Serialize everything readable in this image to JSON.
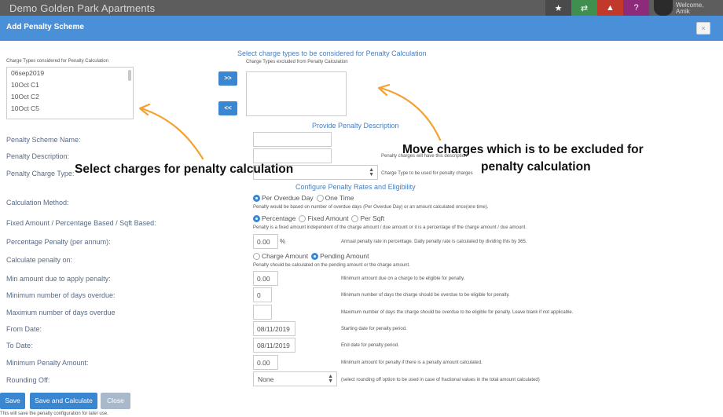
{
  "topbar": {
    "app_title": "Demo Golden Park Apartments",
    "icons": [
      "star-icon",
      "shuffle-icon",
      "bell-icon",
      "help-icon"
    ],
    "welcome_line1": "Welcome,",
    "welcome_line2": "Amik"
  },
  "modal": {
    "title": "Add Penalty Scheme",
    "close_glyph": "×"
  },
  "charge_section": {
    "heading": "Select charge types to be considered for Penalty Calculation",
    "considered_label": "Charge Types considered for Penalty Calculation",
    "excluded_label": "Charge Types excluded from Penalty Calculation",
    "considered_items": [
      "06sep2019",
      "10Oct C1",
      "10Oct C2",
      "10Oct C5"
    ],
    "move_right": ">>",
    "move_left": "<<"
  },
  "description_section": {
    "heading": "Provide Penalty Description"
  },
  "fields": {
    "scheme_name_label": "Penalty Scheme Name:",
    "description_label": "Penalty Description:",
    "description_help": "Penalty charges will have this description",
    "charge_type_label": "Penalty Charge Type:",
    "charge_type_help": "Charge Type to be used for penalty charges",
    "rates_heading": "Configure Penalty Rates and Eligibility",
    "calc_method_label": "Calculation Method:",
    "calc_method_options": [
      "Per Overdue Day",
      "One Time"
    ],
    "calc_method_help": "Penalty would be based on number of overdue days (Per Overdue Day) or an amount calculated once(one time).",
    "fixed_label": "Fixed Amount / Percentage Based / Sqft Based:",
    "fixed_options": [
      "Percentage",
      "Fixed Amount",
      "Per Sqft"
    ],
    "fixed_help": "Penalty is a fixed amount independent of the charge amount / due amount or it is a percentage of the charge amount / due amount.",
    "pct_label": "Percentage Penalty (per annum):",
    "pct_value": "0.00",
    "pct_unit": "%",
    "pct_help": "Annual penalty rate in percentage. Daily penalty rate is calculated by dividing this by 365.",
    "calc_on_label": "Calculate penalty on:",
    "calc_on_options": [
      "Charge Amount",
      "Pending Amount"
    ],
    "calc_on_help": "Penalty should be calculated on the pending amount or the charge amount.",
    "min_amount_label": "Min amount due to apply penalty:",
    "min_amount_value": "0.00",
    "min_amount_help": "Minimum amount due on a charge to be eligible for penalty.",
    "min_days_label": "Minimum number of days overdue:",
    "min_days_value": "0",
    "min_days_help": "Minimum number of days the charge should be overdue to be eligible for penalty.",
    "max_days_label": "Maximum number of days overdue",
    "max_days_value": "",
    "max_days_help": "Maximum number of days the charge should be overdue to be eligible for penalty. Leave blank if not applicable.",
    "from_label": "From Date:",
    "from_value": "08/11/2019",
    "from_help": "Starting date for penalty period.",
    "to_label": "To Date:",
    "to_value": "08/11/2019",
    "to_help": "End date for penalty period.",
    "min_penalty_label": "Minimum Penalty Amount:",
    "min_penalty_value": "0.00",
    "min_penalty_help": "Minimum amount for penalty if there is a penalty amount calculated.",
    "rounding_label": "Rounding Off:",
    "rounding_value": "None",
    "rounding_help": "(select rounding off option to be used in case of fractional values in the total amount calculated)"
  },
  "buttons": {
    "save": "Save",
    "save_calc": "Save and Calculate",
    "close": "Close"
  },
  "footer_note": "This will save the penalty configuration for later use.",
  "annotations": {
    "left": "Select charges for penalty calculation",
    "right_line1": "Move charges which is to be excluded for",
    "right_line2": "penalty calculation",
    "arrow_color": "#f5a030"
  }
}
